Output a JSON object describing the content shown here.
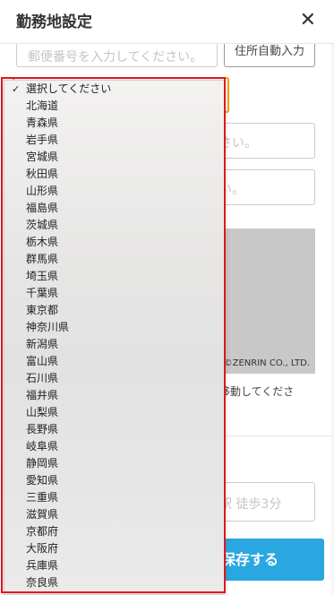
{
  "header": {
    "title": "勤務地設定",
    "close": "✕"
  },
  "form": {
    "postal_placeholder": "郵便番号を入力してください。",
    "auto_input_label": "住所自動入力",
    "field_a_placeholder": "さい。",
    "field_b_placeholder": "い。",
    "map_credit": "©ZENRIN CO., LTD.",
    "map_note": "移動してくださ",
    "station_placeholder": "駅 徒歩3分",
    "save_label": "保存する"
  },
  "dropdown": {
    "selected": "選択してください",
    "options": [
      "選択してください",
      "北海道",
      "青森県",
      "岩手県",
      "宮城県",
      "秋田県",
      "山形県",
      "福島県",
      "茨城県",
      "栃木県",
      "群馬県",
      "埼玉県",
      "千葉県",
      "東京都",
      "神奈川県",
      "新潟県",
      "富山県",
      "石川県",
      "福井県",
      "山梨県",
      "長野県",
      "岐阜県",
      "静岡県",
      "愛知県",
      "三重県",
      "滋賀県",
      "京都府",
      "大阪府",
      "兵庫県",
      "奈良県"
    ]
  },
  "colors": {
    "accent": "#2aa7e0",
    "focus": "#f3a000",
    "highlight": "#e0161e"
  }
}
